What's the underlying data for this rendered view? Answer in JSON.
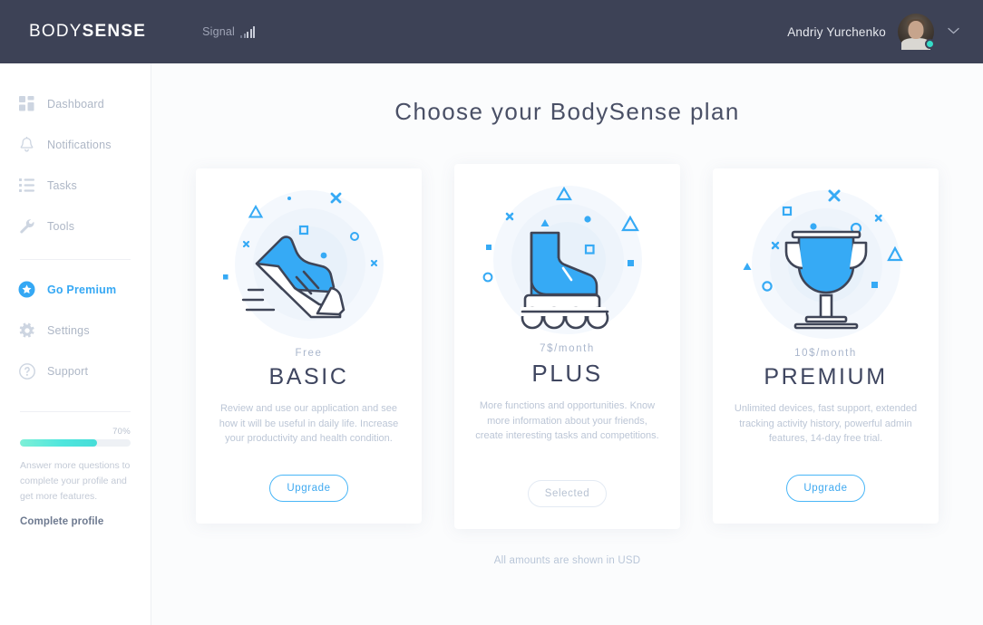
{
  "topbar": {
    "logo_light": "BODY",
    "logo_bold": "SENSE",
    "signal_label": "Signal",
    "signal_icon": "signal-bars-icon",
    "user_name": "Andriy Yurchenko",
    "avatar_icon": "user-avatar",
    "status_icon": "online-status-dot",
    "chevron_icon": "chevron-down-icon"
  },
  "sidebar": {
    "items": [
      {
        "label": "Dashboard",
        "icon": "grid-icon"
      },
      {
        "label": "Notifications",
        "icon": "bell-icon"
      },
      {
        "label": "Tasks",
        "icon": "list-icon"
      },
      {
        "label": "Tools",
        "icon": "wrench-icon"
      }
    ],
    "premium": {
      "label": "Go Premium",
      "icon": "star-badge-icon"
    },
    "secondary": [
      {
        "label": "Settings",
        "icon": "gear-icon"
      },
      {
        "label": "Support",
        "icon": "question-circle-icon"
      }
    ],
    "progress": {
      "percent_label": "70%",
      "percent_value": 70,
      "hint": "Answer more questions to complete your profile and get more features.",
      "cta": "Complete profile"
    }
  },
  "main": {
    "title": "Choose your BodySense plan",
    "footnote": "All amounts are shown in USD",
    "plans": [
      {
        "id": "basic",
        "illustration": "running-shoe-icon",
        "price": "Free",
        "name": "BASIC",
        "description": "Review and use our application and see how it will be useful in daily life. Increase your productivity and health condition.",
        "button_label": "Upgrade",
        "button_state": "upgrade"
      },
      {
        "id": "plus",
        "illustration": "roller-skate-icon",
        "price": "7$/month",
        "name": "PLUS",
        "description": "More functions and opportunities. Know more information about your friends, create interesting tasks and competitions.",
        "button_label": "Selected",
        "button_state": "selected"
      },
      {
        "id": "premium",
        "illustration": "trophy-icon",
        "price": "10$/month",
        "name": "PREMIUM",
        "description": "Unlimited devices, fast support, extended tracking activity history, powerful admin features, 14-day free trial.",
        "button_label": "Upgrade",
        "button_state": "upgrade"
      }
    ]
  },
  "colors": {
    "topbar_bg": "#3d4256",
    "accent_blue": "#35a8f4",
    "illustration_blue": "#36aaf5",
    "illustration_outline": "#3f4557",
    "status_teal": "#35dcc8",
    "text_dark": "#3f4660",
    "text_muted": "#bcc6d6"
  }
}
